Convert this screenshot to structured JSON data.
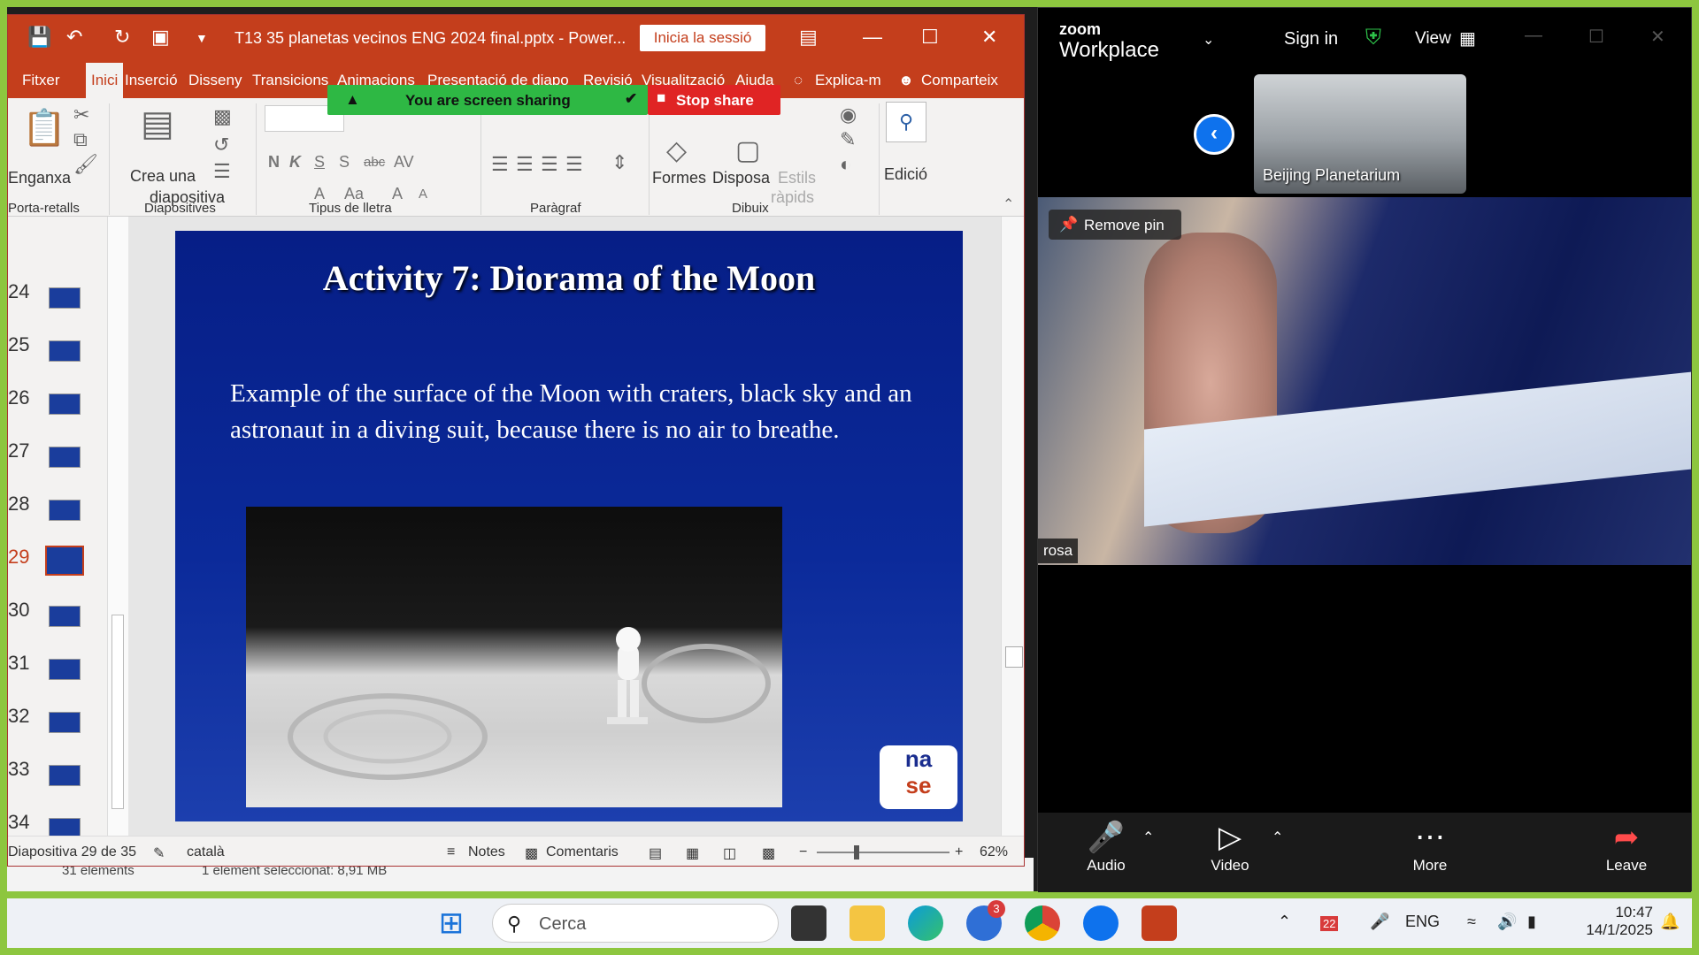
{
  "powerpoint": {
    "file_title": "T13 35 planetas vecinos ENG 2024 final.pptx  -  Power...",
    "signin_label": "Inicia la sessió",
    "tabs": [
      "Fitxer",
      "Inici",
      "Inserció",
      "Disseny",
      "Transicions",
      "Animacions",
      "Presentació de diapo",
      "Revisió",
      "Visualització",
      "Ajuda",
      "Explica-m",
      "Comparteix"
    ],
    "ribbon": {
      "paste_label": "Enganxa",
      "new_slide_label_1": "Crea una",
      "new_slide_label_2": "diapositiva",
      "shapes_label": "Formes",
      "arrange_label": "Disposa",
      "quick_styles_label_1": "Estils",
      "quick_styles_label_2": "ràpids",
      "editing_label": "Edició",
      "group_clipboard": "Porta-retalls",
      "group_slides": "Diapositives",
      "group_font": "Tipus de lletra",
      "group_paragraph": "Paràgraf",
      "group_drawing": "Dibuix"
    },
    "thumbnail_numbers": [
      "24",
      "25",
      "26",
      "27",
      "28",
      "29",
      "30",
      "31",
      "32",
      "33",
      "34"
    ],
    "current_thumbnail": "29",
    "slide": {
      "title": "Activity 7: Diorama of the Moon",
      "body": "Example of the surface of the Moon with craters, black sky and an astronaut in a diving suit, because there is no air to breathe.",
      "logo_top": "na",
      "logo_bottom": "se"
    },
    "status": {
      "slide_count": "Diapositiva 29 de 35",
      "language": "català",
      "notes": "Notes",
      "comments": "Comentaris",
      "zoom_level": "62%"
    }
  },
  "screen_share": {
    "sharing_label": "You are screen sharing",
    "stop_label": "Stop share"
  },
  "explorer": {
    "elements": "31 elements",
    "selected": "1 element seleccionat: 8,91 MB"
  },
  "zoom": {
    "brand_top": "zoom",
    "brand_bottom": "Workplace",
    "sign_in": "Sign in",
    "view": "View",
    "thumbnail_name": "Beijing Planetarium",
    "remove_pin": "Remove pin",
    "speaker_name": "rosa",
    "controls": {
      "audio": "Audio",
      "video": "Video",
      "more": "More",
      "leave": "Leave"
    }
  },
  "taskbar": {
    "search_placeholder": "Cerca",
    "notification_badge": "3",
    "calendar_badge": "22",
    "language": "ENG",
    "time": "10:47",
    "date": "14/1/2025"
  },
  "colors": {
    "ppt_red": "#c43e1c",
    "share_green": "#2eb844",
    "stop_red": "#e02424",
    "slide_blue": "#0b2a9a",
    "zoom_back_blue": "#0e72ed"
  }
}
